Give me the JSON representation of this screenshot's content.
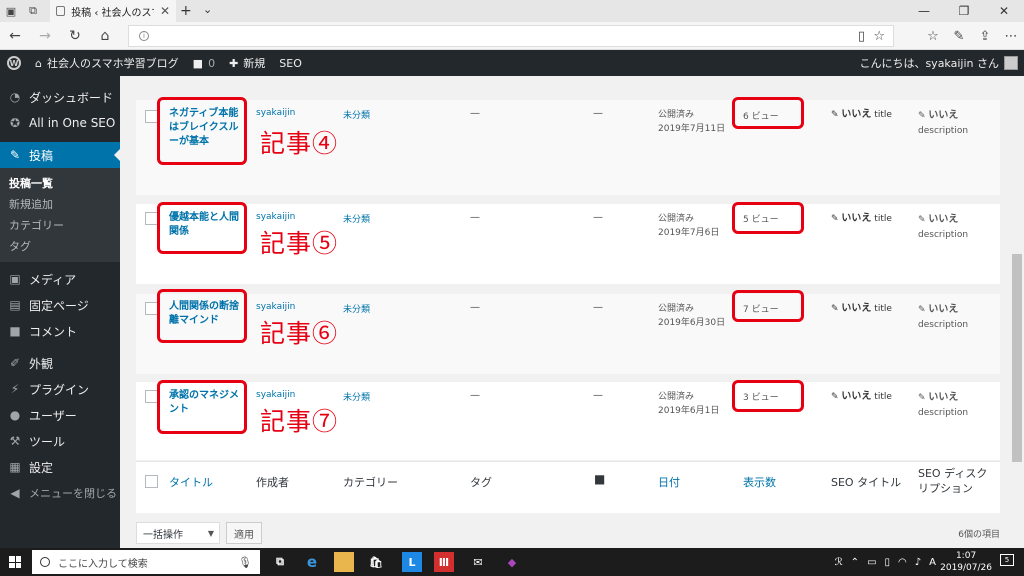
{
  "browser": {
    "tab_title": "投稿 ‹ 社会人のスマホ学習",
    "tab_close": "✕",
    "new_tab": "+",
    "tab_menu": "⌄",
    "window_min": "—",
    "window_max": "❐",
    "window_close": "✕",
    "icons": [
      "back-icon",
      "forward-icon",
      "refresh-icon",
      "home-icon",
      "reading-view-icon",
      "favorite-star-icon",
      "favorites-list-icon",
      "pen-icon",
      "share-icon",
      "more-icon"
    ]
  },
  "adminbar": {
    "site_name": "社会人のスマホ学習ブログ",
    "comments_count": "0",
    "new_label": "新規",
    "seo_label": "SEO",
    "greeting": "こんにちは、syakaijin さん"
  },
  "sidebar": {
    "items": [
      {
        "label": "ダッシュボード",
        "icon": "dashboard-icon"
      },
      {
        "label": "All in One SEO",
        "icon": "seo-gear-icon"
      },
      {
        "label": "投稿",
        "icon": "pushpin-icon",
        "active": true
      },
      {
        "label": "メディア",
        "icon": "media-icon"
      },
      {
        "label": "固定ページ",
        "icon": "page-icon"
      },
      {
        "label": "コメント",
        "icon": "comment-icon"
      },
      {
        "label": "外観",
        "icon": "paintbrush-icon"
      },
      {
        "label": "プラグイン",
        "icon": "plugin-icon"
      },
      {
        "label": "ユーザー",
        "icon": "user-icon"
      },
      {
        "label": "ツール",
        "icon": "wrench-icon"
      },
      {
        "label": "設定",
        "icon": "settings-icon"
      }
    ],
    "submenu": [
      "投稿一覧",
      "新規追加",
      "カテゴリー",
      "タグ"
    ],
    "collapse": "メニューを閉じる"
  },
  "posts": [
    {
      "title": "ネガティブ本能はブレイクスルーが基本",
      "author": "syakaijin",
      "category": "未分類",
      "tags": "—",
      "comments": "—",
      "status": "公開済み",
      "date": "2019年7月11日",
      "views": "6 ビュー",
      "seo_title_value": "いいえ",
      "seo_title_label": "title",
      "seo_desc_value": "いいえ",
      "seo_desc_label": "description",
      "note": "記事④"
    },
    {
      "title": "優越本能と人間関係",
      "author": "syakaijin",
      "category": "未分類",
      "tags": "—",
      "comments": "—",
      "status": "公開済み",
      "date": "2019年7月6日",
      "views": "5 ビュー",
      "seo_title_value": "いいえ",
      "seo_title_label": "title",
      "seo_desc_value": "いいえ",
      "seo_desc_label": "description",
      "note": "記事⑤"
    },
    {
      "title": "人間関係の断捨離マインド",
      "author": "syakaijin",
      "category": "未分類",
      "tags": "—",
      "comments": "—",
      "status": "公開済み",
      "date": "2019年6月30日",
      "views": "7 ビュー",
      "seo_title_value": "いいえ",
      "seo_title_label": "title",
      "seo_desc_value": "いいえ",
      "seo_desc_label": "description",
      "note": "記事⑥"
    },
    {
      "title": "承認のマネジメント",
      "author": "syakaijin",
      "category": "未分類",
      "tags": "—",
      "comments": "—",
      "status": "公開済み",
      "date": "2019年6月1日",
      "views": "3 ビュー",
      "seo_title_value": "いいえ",
      "seo_title_label": "title",
      "seo_desc_value": "いいえ",
      "seo_desc_label": "description",
      "note": "記事⑦"
    }
  ],
  "columns": {
    "title": "タイトル",
    "author": "作成者",
    "category": "カテゴリー",
    "tags": "タグ",
    "date": "日付",
    "views": "表示数",
    "seo_title": "SEO タイトル",
    "seo_desc": "SEO ディスクリプション"
  },
  "footer": {
    "bulk_action": "一括操作",
    "apply": "適用",
    "item_count": "6個の項目"
  },
  "taskbar": {
    "search_placeholder": "ここに入力して検索",
    "time": "1:07",
    "date": "2019/07/26",
    "ime": "A",
    "apps": [
      "task-view-icon",
      "edge-icon",
      "folder-icon",
      "store-icon",
      "l-app-icon",
      "red-app-icon",
      "mail-icon",
      "map-pin-icon"
    ]
  },
  "colors": {
    "accent": "#0073aa",
    "highlight": "#e60012",
    "admin_dark": "#23282d"
  }
}
